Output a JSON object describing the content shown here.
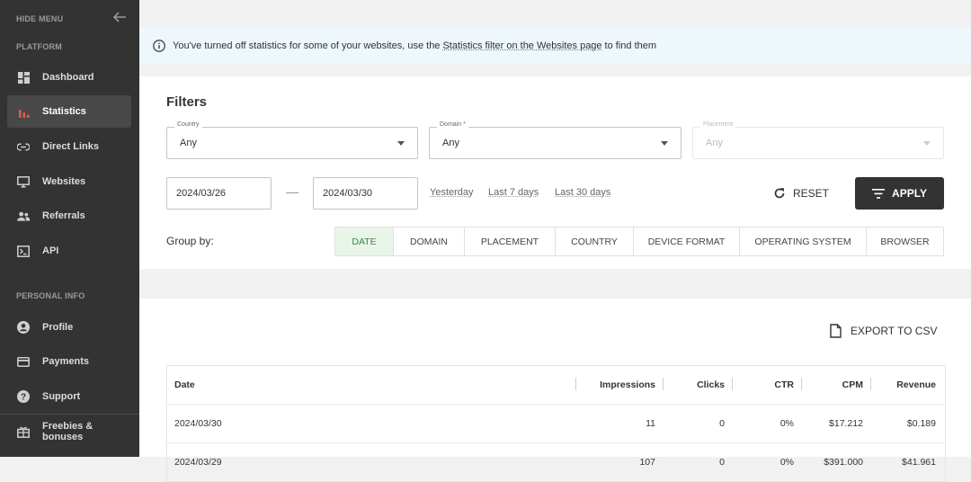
{
  "sidebar": {
    "hide_menu": "HIDE MENU",
    "platform_section": "PLATFORM",
    "personal_section": "PERSONAL INFO",
    "items": [
      {
        "label": "Dashboard",
        "icon": "dashboard-icon"
      },
      {
        "label": "Statistics",
        "icon": "bar-chart-icon",
        "active": true
      },
      {
        "label": "Direct Links",
        "icon": "link-icon"
      },
      {
        "label": "Websites",
        "icon": "monitor-icon"
      },
      {
        "label": "Referrals",
        "icon": "people-icon"
      },
      {
        "label": "API",
        "icon": "terminal-icon"
      }
    ],
    "personal_items": [
      {
        "label": "Profile",
        "icon": "user-icon"
      },
      {
        "label": "Payments",
        "icon": "credit-card-icon"
      },
      {
        "label": "Support",
        "icon": "help-icon"
      }
    ],
    "bottom_item": {
      "label": "Freebies & bonuses",
      "icon": "gift-icon"
    }
  },
  "notice": {
    "text_before": "You've turned off statistics for some of your websites, use the",
    "link": "Statistics filter on the Websites page",
    "text_after": "to find them"
  },
  "filters": {
    "title": "Filters",
    "country": {
      "label": "Country",
      "value": "Any"
    },
    "domain": {
      "label": "Domain *",
      "value": "Any"
    },
    "placement": {
      "label": "Placement",
      "value": "Any"
    },
    "date_from": "2024/03/26",
    "date_to": "2024/03/30",
    "quick": [
      "Yesterday",
      "Last 7 days",
      "Last 30 days"
    ],
    "reset_label": "RESET",
    "apply_label": "APPLY",
    "group_by_label": "Group by:",
    "group_by_options": [
      "DATE",
      "DOMAIN",
      "PLACEMENT",
      "COUNTRY",
      "DEVICE FORMAT",
      "OPERATING SYSTEM",
      "BROWSER"
    ],
    "group_by_selected": "DATE"
  },
  "results": {
    "export_label": "EXPORT TO CSV",
    "columns": [
      "Date",
      "Impressions",
      "Clicks",
      "CTR",
      "CPM",
      "Revenue"
    ],
    "rows": [
      [
        "2024/03/30",
        "11",
        "0",
        "0%",
        "$17.212",
        "$0.189"
      ],
      [
        "2024/03/29",
        "107",
        "0",
        "0%",
        "$391.000",
        "$41.961"
      ]
    ]
  },
  "colors": {
    "sidebar_bg": "#333333",
    "active_accent": "#e05a4f",
    "notice_bg": "#eef7fc",
    "apply_bg": "#333333",
    "groupby_active_bg": "#e9f5e9",
    "groupby_active_text": "#3a8a3a"
  }
}
